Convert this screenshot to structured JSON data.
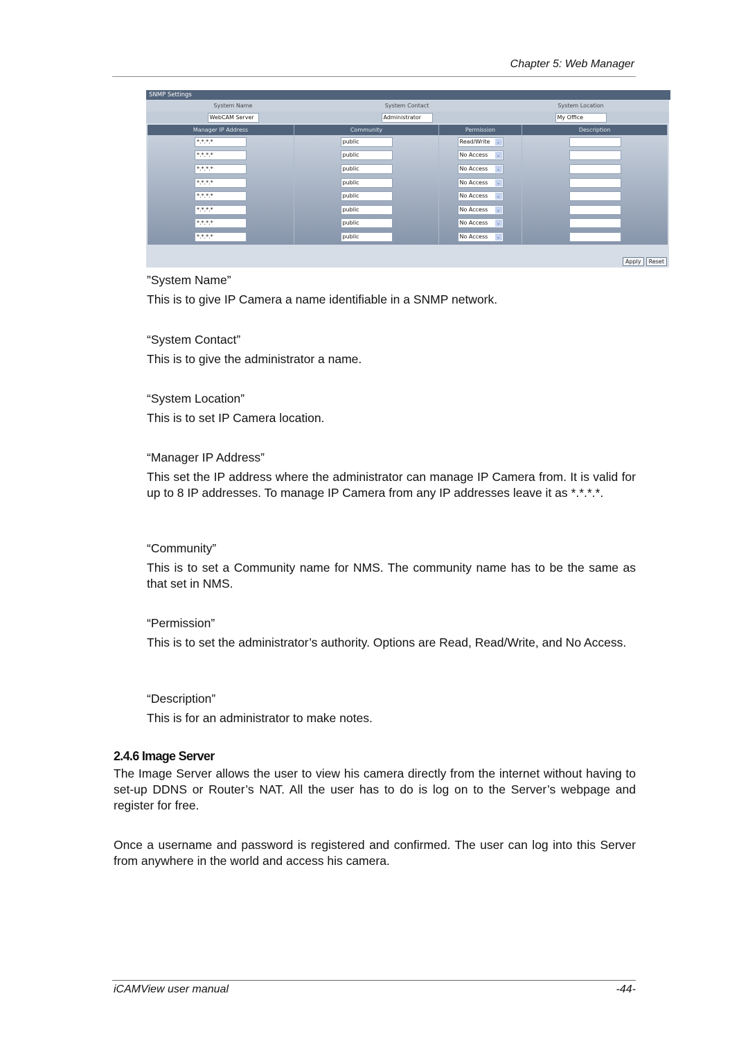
{
  "header": {
    "chapter": "Chapter 5: Web Manager"
  },
  "snmp": {
    "title": "SNMP Settings",
    "system": {
      "labels": [
        "System Name",
        "System Contact",
        "System Location"
      ],
      "values": [
        "WebCAM Server",
        "Administrator",
        "My Office"
      ]
    },
    "columns": [
      "Manager IP Address",
      "Community",
      "Permission",
      "Description"
    ],
    "rows": [
      {
        "ip": "*.*.*.*",
        "community": "public",
        "permission": "Read/Write",
        "description": ""
      },
      {
        "ip": "*.*.*.*",
        "community": "public",
        "permission": "No Access",
        "description": ""
      },
      {
        "ip": "*.*.*.*",
        "community": "public",
        "permission": "No Access",
        "description": ""
      },
      {
        "ip": "*.*.*.*",
        "community": "public",
        "permission": "No Access",
        "description": ""
      },
      {
        "ip": "*.*.*.*",
        "community": "public",
        "permission": "No Access",
        "description": ""
      },
      {
        "ip": "*.*.*.*",
        "community": "public",
        "permission": "No Access",
        "description": ""
      },
      {
        "ip": "*.*.*.*",
        "community": "public",
        "permission": "No Access",
        "description": ""
      },
      {
        "ip": "*.*.*.*",
        "community": "public",
        "permission": "No Access",
        "description": ""
      }
    ],
    "apply_label": "Apply",
    "reset_label": "Reset",
    "select_arrow": "chevron-down-icon"
  },
  "descriptions": [
    {
      "term": "”System Name”",
      "text": "This is to give IP Camera a name identifiable in a SNMP network."
    },
    {
      "term": "“System Contact”",
      "text": "This is to give the administrator a name."
    },
    {
      "term": "“System Location”",
      "text": "This is to set IP Camera location."
    },
    {
      "term": "“Manager IP Address”",
      "text": "This set the IP address where the administrator can manage IP Camera from. It is valid for up to 8 IP addresses.  To manage IP Camera from any IP addresses leave it as *.*.*.*."
    },
    {
      "term": "“Community”",
      "text": "This is to set a Community name for NMS. The community name has to be the same as that set in NMS."
    },
    {
      "term": "“Permission”",
      "text": "This is to set the administrator’s authority. Options are Read, Read/Write, and No Access."
    },
    {
      "term": "“Description”",
      "text": "This is for an administrator to make notes."
    }
  ],
  "section": {
    "title": "2.4.6 Image Server",
    "paragraphs": [
      "The Image Server allows the user to view his camera directly from the internet without having to set-up DDNS or Router’s NAT.  All the user has to do is log on to the Server’s webpage and register for free.",
      "Once a username and password is registered and confirmed.  The user can log into this Server from anywhere in the world and access his camera."
    ]
  },
  "footer": {
    "manual": "iCAMView  user  manual",
    "page": "-44-"
  }
}
